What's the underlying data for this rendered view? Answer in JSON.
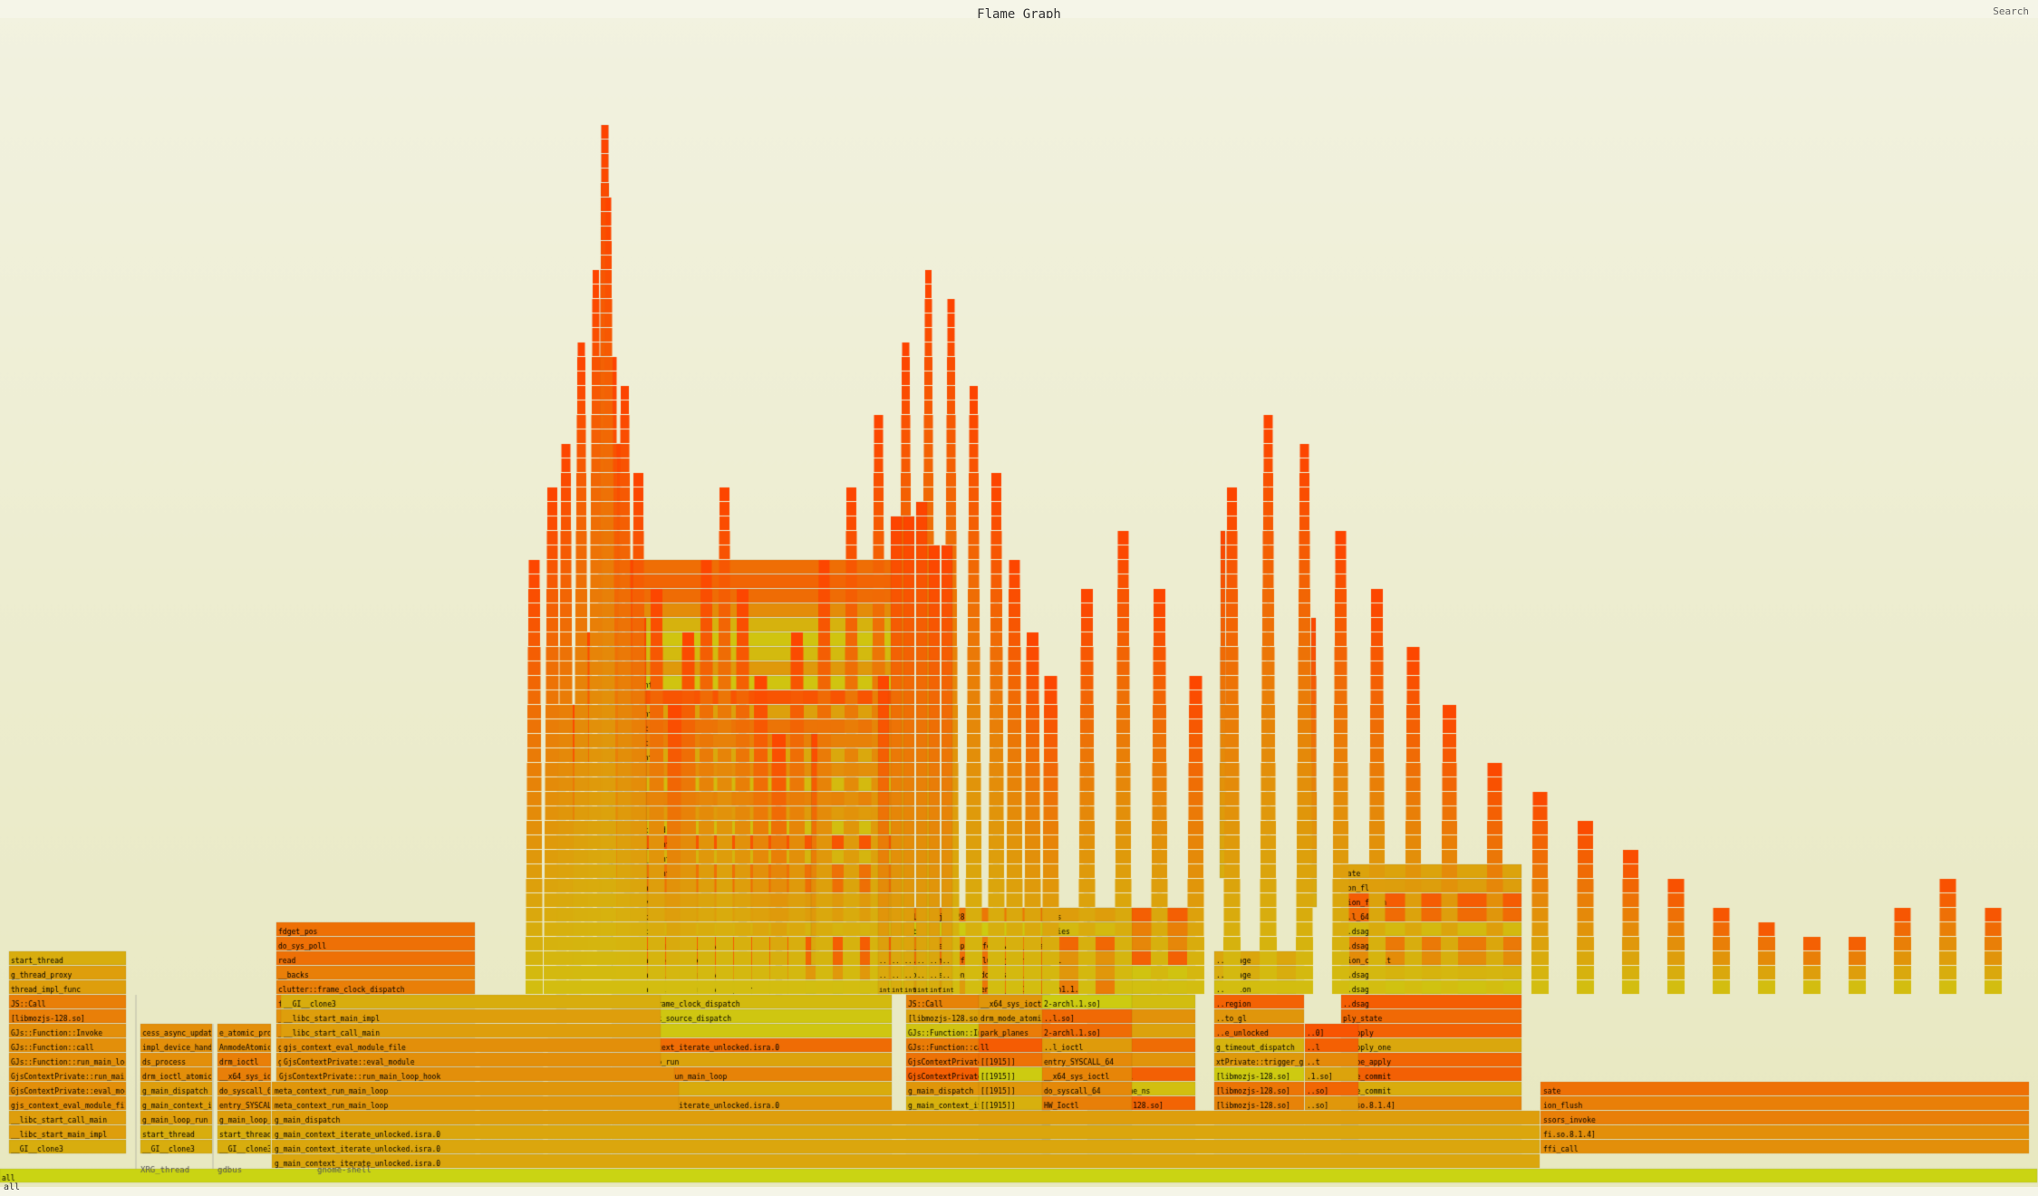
{
  "title": "Flame Graph",
  "search_button": "Search",
  "bottom_label": "all",
  "colors": {
    "background_top": "#f0f0d8",
    "background_bottom": "#e8e8c0",
    "frame_red": "#e84040",
    "frame_orange": "#e88020",
    "frame_yellow": "#e8c000",
    "frame_dark_red": "#c82020"
  }
}
